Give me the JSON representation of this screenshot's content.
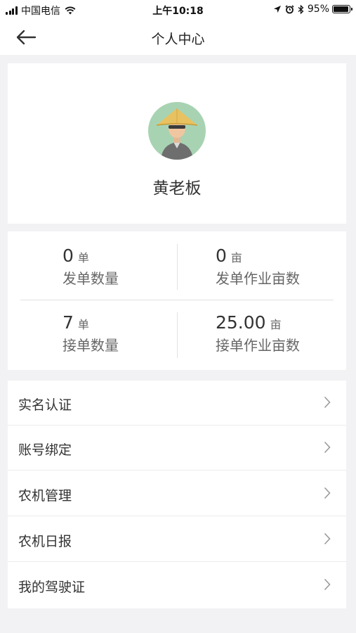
{
  "status_bar": {
    "carrier": "中国电信",
    "time": "上午10:18",
    "battery": "95%",
    "battery_level": 0.95,
    "icons": [
      "signal-icon",
      "wifi-icon",
      "location-arrow-icon",
      "alarm-icon",
      "bluetooth-icon",
      "battery-icon"
    ]
  },
  "nav": {
    "title": "个人中心",
    "back_icon": "back-arrow-icon"
  },
  "profile": {
    "name": "黄老板",
    "avatar_icon": "farmer-avatar-icon",
    "avatar_bg": "#a8d3b3"
  },
  "stats": {
    "sent_orders": {
      "value": "0",
      "unit": "单",
      "label": "发单数量"
    },
    "sent_area": {
      "value": "0",
      "unit": "亩",
      "label": "发单作业亩数"
    },
    "received_orders": {
      "value": "7",
      "unit": "单",
      "label": "接单数量"
    },
    "received_area": {
      "value": "25.00",
      "unit": "亩",
      "label": "接单作业亩数"
    }
  },
  "menu": {
    "items": [
      {
        "label": "实名认证"
      },
      {
        "label": "账号绑定"
      },
      {
        "label": "农机管理"
      },
      {
        "label": "农机日报"
      },
      {
        "label": "我的驾驶证"
      }
    ],
    "chevron_icon": "chevron-right-icon"
  },
  "colors": {
    "background": "#f2f2f4",
    "card": "#ffffff",
    "text_primary": "#333333",
    "text_secondary": "#666666"
  }
}
